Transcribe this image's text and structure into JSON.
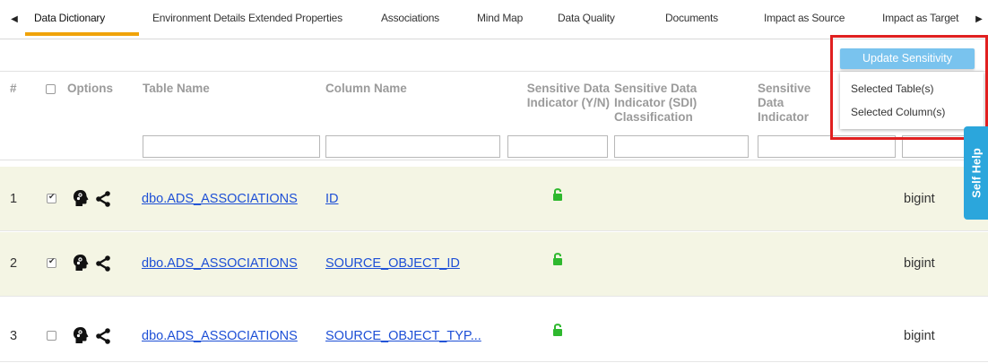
{
  "tabs": [
    {
      "label": "Data Dictionary"
    },
    {
      "label": "Environment Details"
    },
    {
      "label": "Extended Properties"
    },
    {
      "label": "Associations"
    },
    {
      "label": "Mind Map"
    },
    {
      "label": "Data Quality"
    },
    {
      "label": "Documents"
    },
    {
      "label": "Impact as Source"
    },
    {
      "label": "Impact as Target"
    }
  ],
  "header": {
    "num": "#",
    "options": "Options",
    "table_name": "Table Name",
    "column_name": "Column Name",
    "sdi_yn": "Sensitive Data Indicator (Y/N)",
    "sdi_class": "Sensitive Data Indicator (SDI) Classification",
    "sdi_desc": "Sensitive Data Indicator (SDI) Description"
  },
  "popup": {
    "update_label": "Update Sensitivity",
    "items": [
      "Selected Table(s)",
      "Selected Column(s)"
    ]
  },
  "rows": [
    {
      "num": "1",
      "checked": true,
      "table": "dbo.ADS_ASSOCIATIONS",
      "column": "ID",
      "datatype": "bigint"
    },
    {
      "num": "2",
      "checked": true,
      "table": "dbo.ADS_ASSOCIATIONS",
      "column": "SOURCE_OBJECT_ID",
      "datatype": "bigint"
    },
    {
      "num": "3",
      "checked": false,
      "table": "dbo.ADS_ASSOCIATIONS",
      "column": "SOURCE_OBJECT_TYP...",
      "datatype": "bigint"
    }
  ],
  "self_help": "Self Help",
  "colors": {
    "tab_underline": "#f0a30a",
    "link": "#1d4fd6",
    "selected_row": "#f4f5e4",
    "update_button": "#79c3ee",
    "self_help": "#2ba6dc",
    "highlight_frame": "#e02020",
    "lock": "#2eb82e"
  },
  "icons": [
    "caret-left-icon",
    "caret-right-icon",
    "mind-map-head-icon",
    "share-icon",
    "unlock-icon"
  ]
}
